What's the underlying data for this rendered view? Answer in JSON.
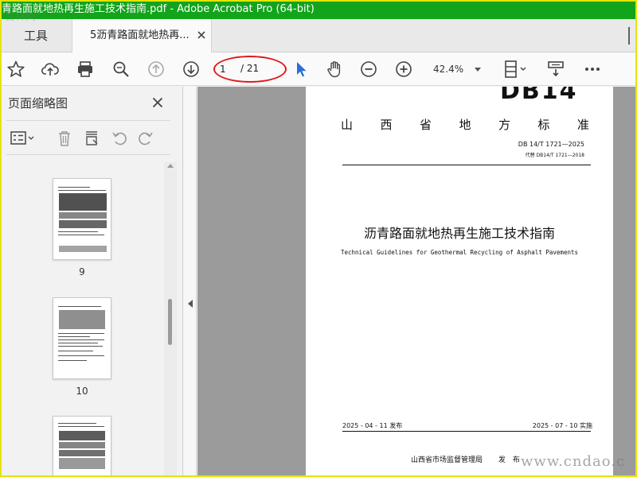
{
  "window": {
    "title": "青路面就地热再生施工技术指南.pdf - Adobe Acrobat Pro (64-bit)"
  },
  "tabs": {
    "tools_label": "工具",
    "document_label": "5沥青路面就地热再..."
  },
  "toolbar": {
    "current_page": "1",
    "page_total": "/ 21",
    "zoom": "42.4%",
    "icons": [
      "star-icon",
      "cloud-upload-icon",
      "print-icon",
      "search-icon",
      "page-up-icon",
      "page-down-icon",
      "select-cursor-icon",
      "hand-icon",
      "zoom-out-icon",
      "zoom-in-icon",
      "page-fit-icon",
      "scroll-mode-icon",
      "more-icon"
    ],
    "highlight_color": "#e11a1a"
  },
  "sidebar": {
    "title": "页面缩略图",
    "thumbnails": [
      {
        "page": "9"
      },
      {
        "page": "10"
      },
      {
        "page": ""
      }
    ]
  },
  "document": {
    "logo": "DB14",
    "standard_name": [
      "山",
      "西",
      "省",
      "地",
      "方",
      "标",
      "准"
    ],
    "standard_number": "DB 14/T 1721—2025",
    "replaces": "代替 DB14/T 1721—2018",
    "title": "沥青路面就地热再生施工技术指南",
    "subtitle": "Technical Guidelines for Geothermal Recycling of Asphalt Pavements",
    "publish_date": "2025 - 04 - 11 发布",
    "implement_date": "2025 - 07 - 10 实施",
    "issuer": "山西省市场监督管理局",
    "issue_label": "发 布"
  },
  "watermark": {
    "top": "百林网",
    "bottom": "www.cndao.c"
  },
  "colors": {
    "titlebar": "#12a41a",
    "frame": "#e8e400",
    "select_cursor": "#2b6fd6"
  }
}
